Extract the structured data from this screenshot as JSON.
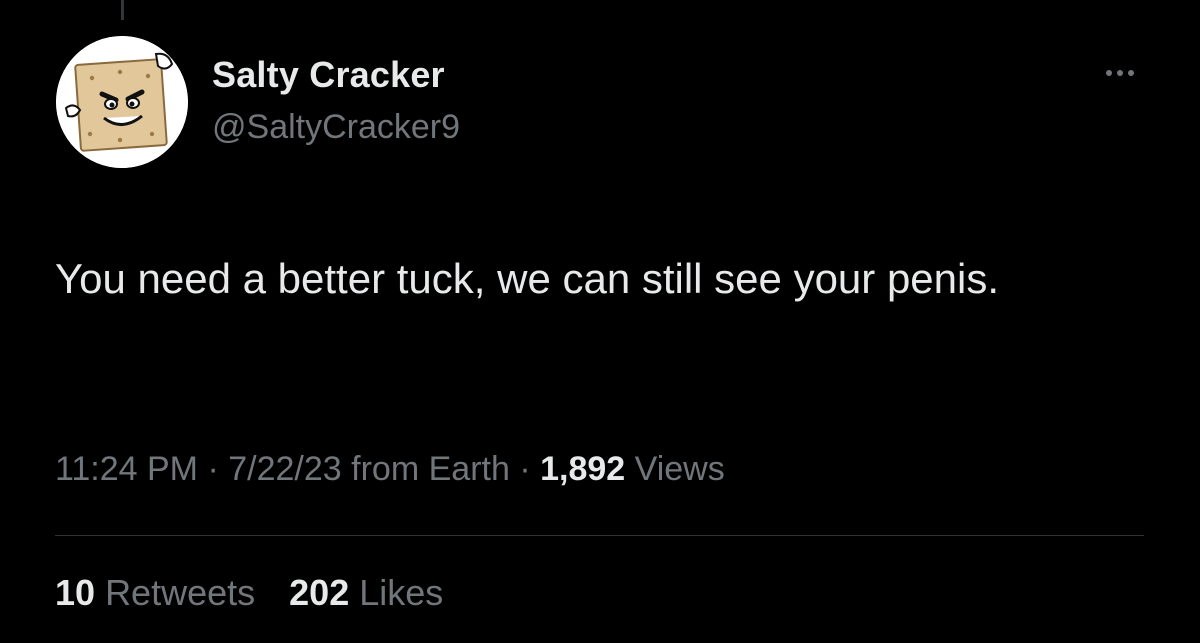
{
  "tweet": {
    "author": {
      "display_name": "Salty Cracker",
      "handle": "@SaltyCracker9",
      "avatar_icon": "cracker-character-icon"
    },
    "more_icon": "more-horizontal-icon",
    "text": "You need a better tuck, we can still see your penis.",
    "time": "11:24 PM",
    "separator": "·",
    "date": "7/22/23",
    "source": "from Earth",
    "views_count": "1,892",
    "views_label": "Views",
    "retweets_count": "10",
    "retweets_label": "Retweets",
    "likes_count": "202",
    "likes_label": "Likes"
  },
  "colors": {
    "background": "#000000",
    "primary_text": "#e7e9ea",
    "secondary_text": "#71767b",
    "divider": "#2f3336"
  }
}
